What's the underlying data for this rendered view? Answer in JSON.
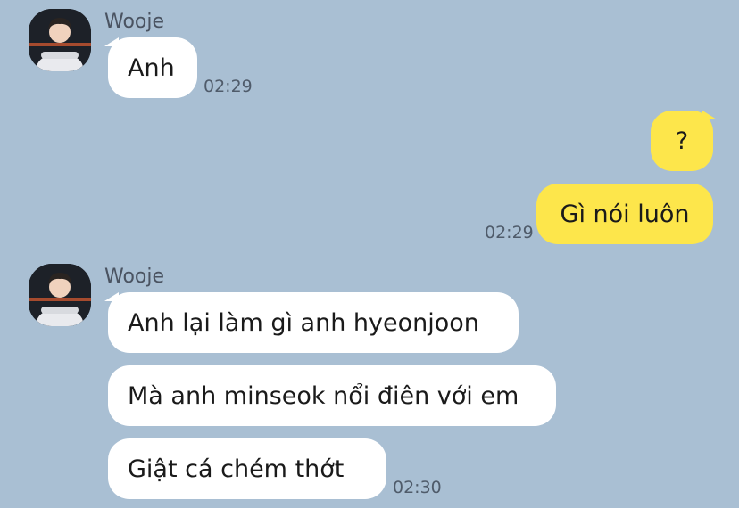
{
  "groups": [
    {
      "sender": "Wooje",
      "messages": [
        {
          "text": "Anh",
          "time": "02:29"
        }
      ]
    },
    {
      "sender": "me",
      "messages": [
        {
          "text": "?",
          "time": ""
        },
        {
          "text": "Gì nói luôn",
          "time": "02:29"
        }
      ]
    },
    {
      "sender": "Wooje",
      "messages": [
        {
          "text": "Anh lại làm gì anh hyeonjoon",
          "time": ""
        },
        {
          "text": "Mà anh minseok nổi điên với em",
          "time": ""
        },
        {
          "text": "Giật cá chém thớt",
          "time": "02:30"
        }
      ]
    }
  ],
  "colors": {
    "background": "#a9bfd3",
    "incoming_bubble": "#ffffff",
    "outgoing_bubble": "#fde64b"
  },
  "icons": {
    "avatar": "profile-photo"
  }
}
